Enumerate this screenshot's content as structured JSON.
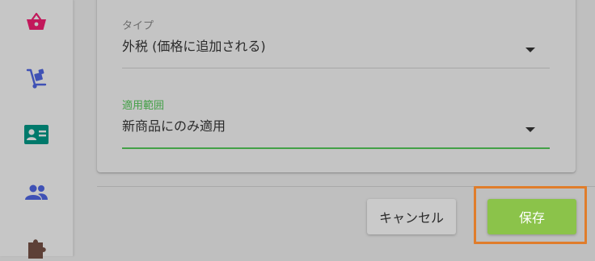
{
  "sidebar": {
    "items": [
      {
        "icon": "basket-icon",
        "color": "#c2185b"
      },
      {
        "icon": "hand-truck-icon",
        "color": "#3f51b5"
      },
      {
        "icon": "contact-card-icon",
        "color": "#00796b"
      },
      {
        "icon": "people-icon",
        "color": "#3f51b5"
      },
      {
        "icon": "puzzle-icon",
        "color": "#5d4037"
      }
    ]
  },
  "form": {
    "type_field": {
      "label": "タイプ",
      "value": "外税 (価格に追加される)"
    },
    "scope_field": {
      "label": "適用範囲",
      "value": "新商品にのみ適用"
    }
  },
  "actions": {
    "cancel_label": "キャンセル",
    "save_label": "保存"
  },
  "colors": {
    "accent_green": "#43a047",
    "save_button": "#8bc34a",
    "highlight": "#e07d2b"
  }
}
